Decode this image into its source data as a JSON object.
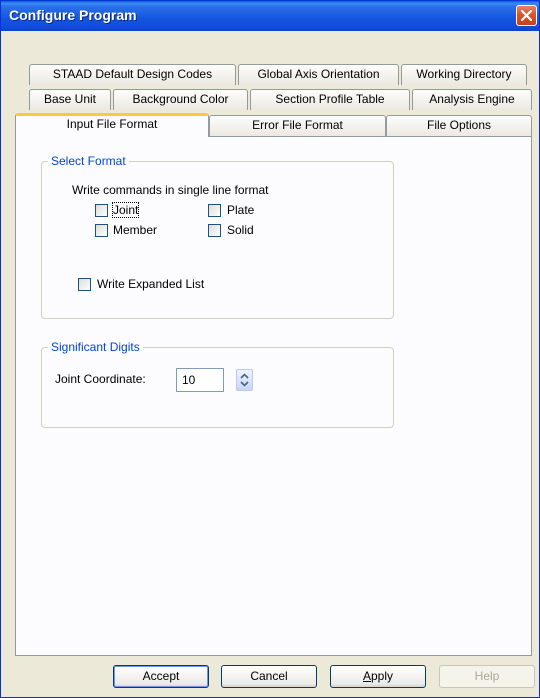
{
  "window": {
    "title": "Configure Program"
  },
  "tabs": {
    "row1": [
      "STAAD Default Design Codes",
      "Global Axis Orientation",
      "Working Directory"
    ],
    "row2": [
      "Base Unit",
      "Background Color",
      "Section Profile Table",
      "Analysis Engine"
    ],
    "row3": [
      "Input File Format",
      "Error File Format",
      "File Options"
    ],
    "active": "Input File Format"
  },
  "select_format": {
    "group_label": "Select Format",
    "instruction": "Write commands in single line format",
    "options": {
      "joint": {
        "label": "Joint",
        "checked": false
      },
      "plate": {
        "label": "Plate",
        "checked": false
      },
      "member": {
        "label": "Member",
        "checked": false
      },
      "solid": {
        "label": "Solid",
        "checked": false
      }
    },
    "expanded_list": {
      "label": "Write Expanded List",
      "checked": false
    }
  },
  "significant_digits": {
    "group_label": "Significant Digits",
    "joint_coordinate_label": "Joint Coordinate:",
    "joint_coordinate_value": "10"
  },
  "buttons": {
    "accept": "Accept",
    "cancel": "Cancel",
    "apply_prefix": "",
    "apply_mnemonic": "A",
    "apply_rest": "pply",
    "help": "Help"
  },
  "colors": {
    "title_bar": "#1657e0",
    "close_button": "#d9542e",
    "group_label": "#0046d5",
    "active_tab_highlight": "#ffc83c"
  }
}
